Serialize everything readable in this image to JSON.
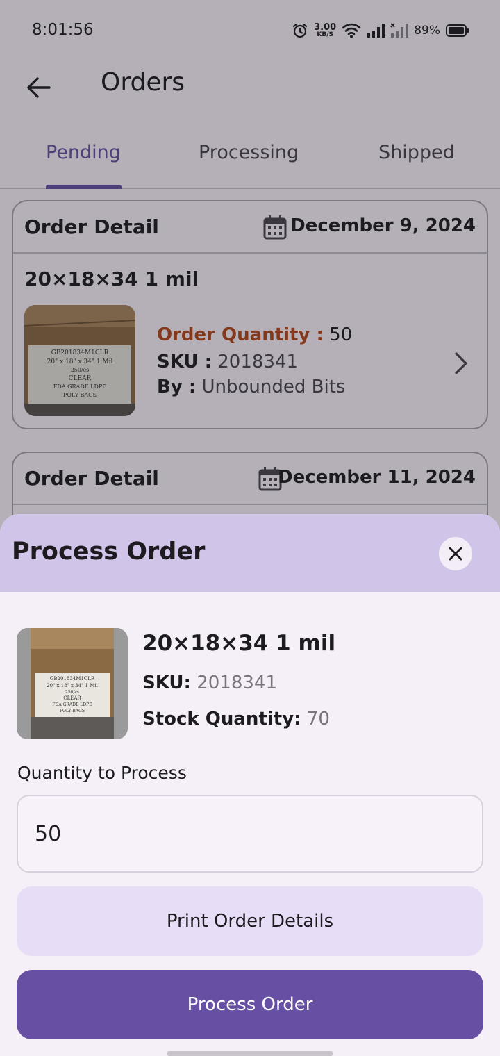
{
  "status_bar": {
    "time": "8:01:56",
    "net_speed_value": "3.00",
    "net_speed_unit": "KB/S",
    "battery_percent": "89%"
  },
  "app_bar": {
    "title": "Orders",
    "back_icon": "arrow-left-icon"
  },
  "tabs": [
    {
      "label": "Pending",
      "active": true
    },
    {
      "label": "Processing",
      "active": false
    },
    {
      "label": "Shipped",
      "active": false
    }
  ],
  "orders": [
    {
      "header": "Order Detail",
      "date": "December 9, 2024",
      "product_name": "20×18×34 1 mil",
      "qty_label": "Order Quantity :",
      "qty_value": "50",
      "sku_label": "SKU :",
      "sku_value": "2018341",
      "by_label": "By :",
      "by_value": "Unbounded Bits",
      "label_text": [
        "GB201834M1CLR",
        "20\" x 18\" x 34\" 1 Mil",
        "250/cs",
        "CLEAR",
        "FDA GRADE LDPE",
        "POLY BAGS"
      ]
    },
    {
      "header": "Order Detail",
      "date": "December 11, 2024"
    }
  ],
  "sheet": {
    "title": "Process Order",
    "close_icon": "close-icon",
    "product_name": "20×18×34 1 mil",
    "sku_label": "SKU:",
    "sku_value": "2018341",
    "stock_label": "Stock Quantity:",
    "stock_value": "70",
    "quantity_label": "Quantity to Process",
    "quantity_value": "50",
    "print_button": "Print Order Details",
    "process_button": "Process Order"
  },
  "colors": {
    "primary": "#6750a4",
    "sheet_header": "#d0c4e8",
    "order_quantity_label": "#b4461a"
  }
}
